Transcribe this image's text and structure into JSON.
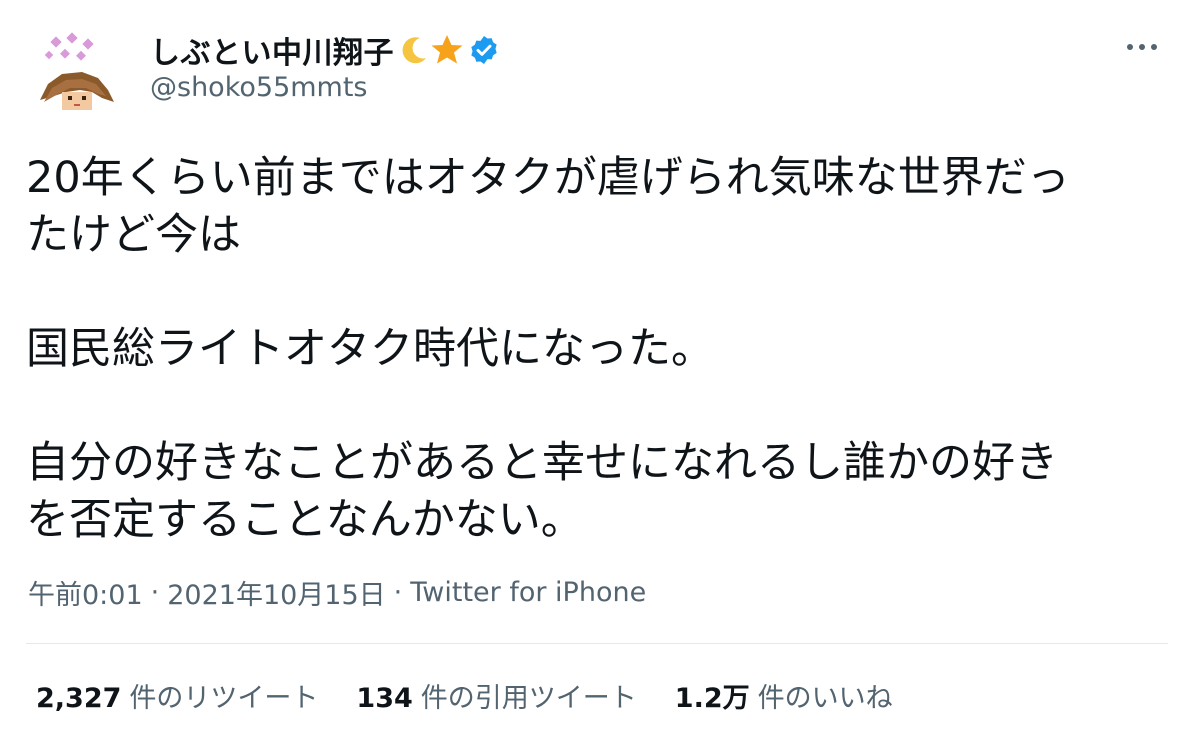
{
  "author": {
    "display_name": "しぶとい中川翔子",
    "handle": "@shoko55mmts",
    "name_emojis": [
      "crescent-moon-icon",
      "star-icon"
    ],
    "verified": true
  },
  "tweet": {
    "paragraphs": [
      [
        "20年くらい前まではオタクが虐げられ気味な世界だっ",
        "たけど今は"
      ],
      [
        "国民総ライトオタク時代になった。"
      ],
      [
        "自分の好きなことがあると幸せになれるし誰かの好き",
        "を否定することなんかない。"
      ]
    ]
  },
  "meta": {
    "time": "午前0:01",
    "date": "2021年10月15日",
    "source": "Twitter for iPhone",
    "separator": "·"
  },
  "stats": {
    "retweets": {
      "count": "2,327",
      "label": "件のリツイート"
    },
    "quotes": {
      "count": "134",
      "label": "件の引用ツイート"
    },
    "likes": {
      "count": "1.2万",
      "label": "件のいいね"
    }
  },
  "colors": {
    "text": "#0f1419",
    "secondary": "#536471",
    "verified": "#1d9bf0",
    "divider": "#e6e9eb"
  }
}
